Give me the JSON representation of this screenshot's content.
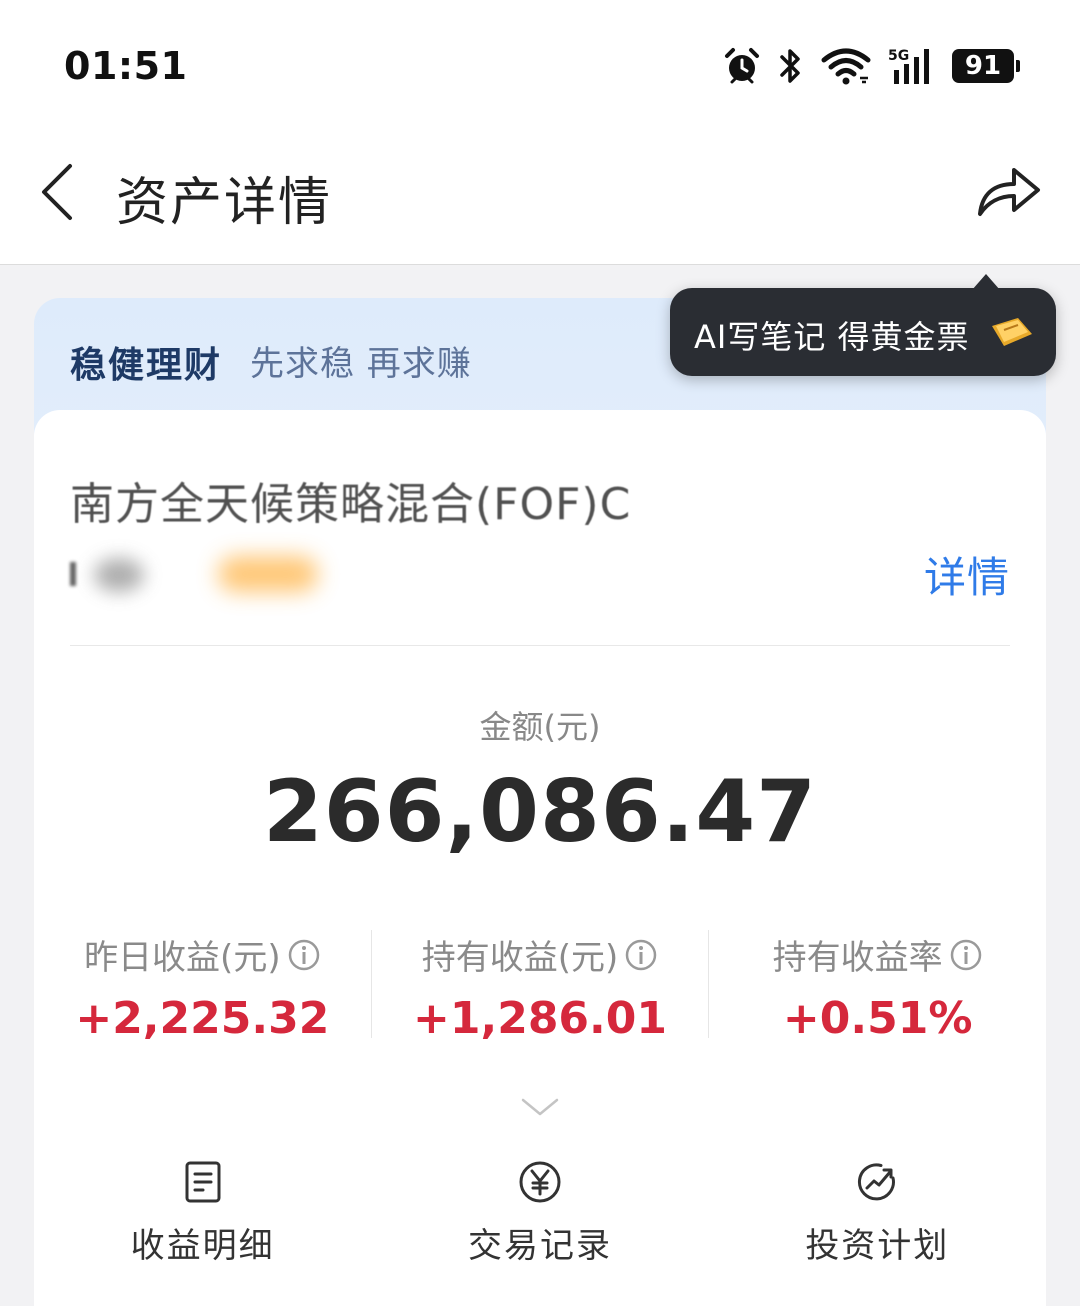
{
  "status_bar": {
    "time": "01:51",
    "network": "5G",
    "battery": "91",
    "icons": [
      "alarm-icon",
      "bluetooth-icon",
      "wifi-icon",
      "signal-icon",
      "battery-icon"
    ]
  },
  "nav": {
    "title": "资产详情",
    "back_icon": "chevron-left-icon",
    "share_icon": "share-icon"
  },
  "banner": {
    "title": "稳健理财",
    "subtitle": "先求稳 再求赚"
  },
  "tooltip": {
    "text": "AI写笔记 得黄金票",
    "icon": "gold-ticket-icon"
  },
  "fund": {
    "name": "南方全天候策略混合(FOF)C",
    "detail_link": "详情"
  },
  "amount": {
    "label": "金额(元)",
    "value": "266,086.47"
  },
  "stats": [
    {
      "label": "昨日收益(元)",
      "value": "+2,225.32"
    },
    {
      "label": "持有收益(元)",
      "value": "+1,286.01"
    },
    {
      "label": "持有收益率",
      "value": "+0.51%"
    }
  ],
  "actions": [
    {
      "label": "收益明细",
      "icon": "document-icon"
    },
    {
      "label": "交易记录",
      "icon": "yuan-icon"
    },
    {
      "label": "投资计划",
      "icon": "trend-icon"
    }
  ],
  "colors": {
    "positive": "#d5283c",
    "link": "#2f7be8",
    "banner_title": "#1e3a66",
    "tooltip_bg": "#2a2d33"
  }
}
